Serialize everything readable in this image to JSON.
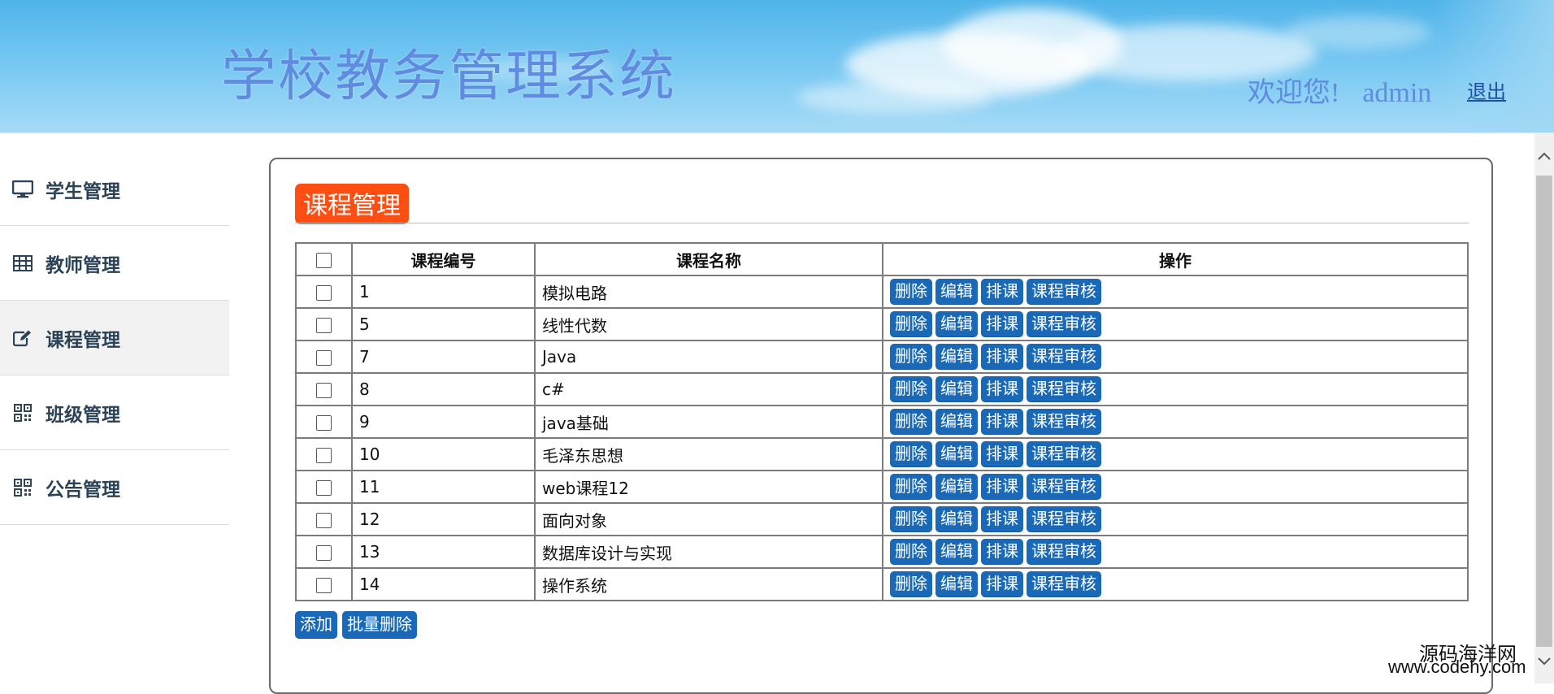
{
  "header": {
    "title": "学校教务管理系统",
    "welcome": "欢迎您!",
    "username": "admin",
    "logout": "退出"
  },
  "sidebar": {
    "items": [
      {
        "label": "学生管理",
        "icon": "monitor-icon"
      },
      {
        "label": "教师管理",
        "icon": "table-icon"
      },
      {
        "label": "课程管理",
        "icon": "edit-icon"
      },
      {
        "label": "班级管理",
        "icon": "qrcode-icon"
      },
      {
        "label": "公告管理",
        "icon": "qrcode-icon"
      }
    ],
    "active_index": 2
  },
  "panel": {
    "title": "课程管理",
    "table": {
      "headers": [
        "课程编号",
        "课程名称",
        "操作"
      ],
      "rows": [
        {
          "id": "1",
          "name": "模拟电路"
        },
        {
          "id": "5",
          "name": "线性代数"
        },
        {
          "id": "7",
          "name": "Java"
        },
        {
          "id": "8",
          "name": "c#"
        },
        {
          "id": "9",
          "name": "java基础"
        },
        {
          "id": "10",
          "name": "毛泽东思想"
        },
        {
          "id": "11",
          "name": "web课程12"
        },
        {
          "id": "12",
          "name": "面向对象"
        },
        {
          "id": "13",
          "name": "数据库设计与实现"
        },
        {
          "id": "14",
          "name": "操作系统"
        }
      ],
      "row_actions": {
        "delete": "删除",
        "edit": "编辑",
        "schedule": "排课",
        "review": "课程审核"
      }
    },
    "add_button": "添加",
    "batch_delete_button": "批量删除"
  },
  "watermark": {
    "line1": "源码海洋网",
    "line2": "www.codehy.com"
  },
  "colors": {
    "title_badge": "#ff4e12",
    "button": "#1a69b8",
    "header_text": "#5f8be0",
    "nav_text": "#2c4257"
  }
}
